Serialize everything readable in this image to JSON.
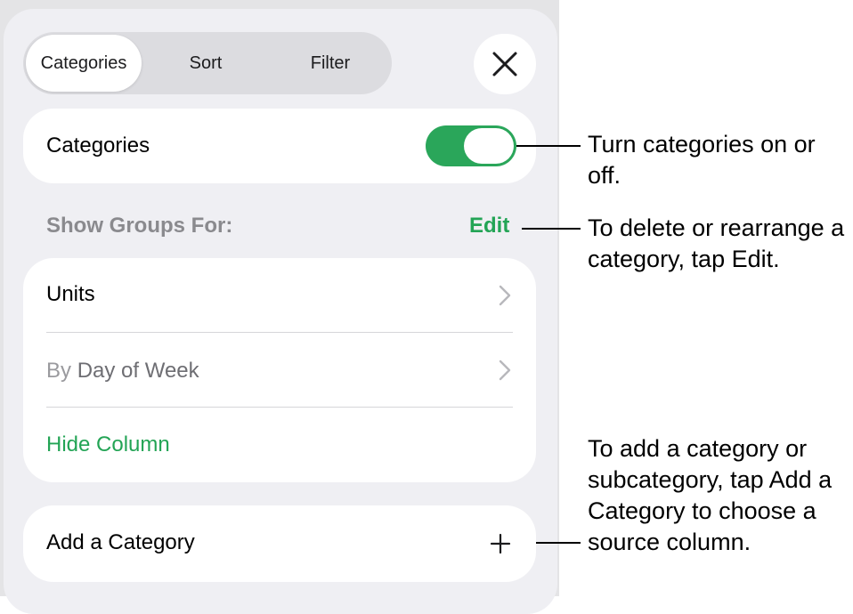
{
  "tabs": [
    {
      "label": "Categories",
      "active": true
    },
    {
      "label": "Sort",
      "active": false
    },
    {
      "label": "Filter",
      "active": false
    }
  ],
  "close_icon": "close-icon",
  "categories_row": {
    "label": "Categories",
    "toggle_on": true
  },
  "section": {
    "title": "Show Groups For:",
    "edit_label": "Edit"
  },
  "groups": {
    "units": {
      "label": "Units"
    },
    "day_of_week": {
      "prefix": "By",
      "label": "Day of Week"
    },
    "hide_column": {
      "label": "Hide Column"
    }
  },
  "add_category": {
    "label": "Add a Category",
    "icon": "plus-icon"
  },
  "callouts": {
    "toggle": "Turn categories on or off.",
    "edit": "To delete or rearrange a category, tap Edit.",
    "add": "To add a category or subcategory, tap Add a Category to choose a source column."
  },
  "colors": {
    "accent": "#23a455",
    "toggle_on": "#2aa65a",
    "panel": "#efeff3",
    "background": "#e4e4e6"
  }
}
